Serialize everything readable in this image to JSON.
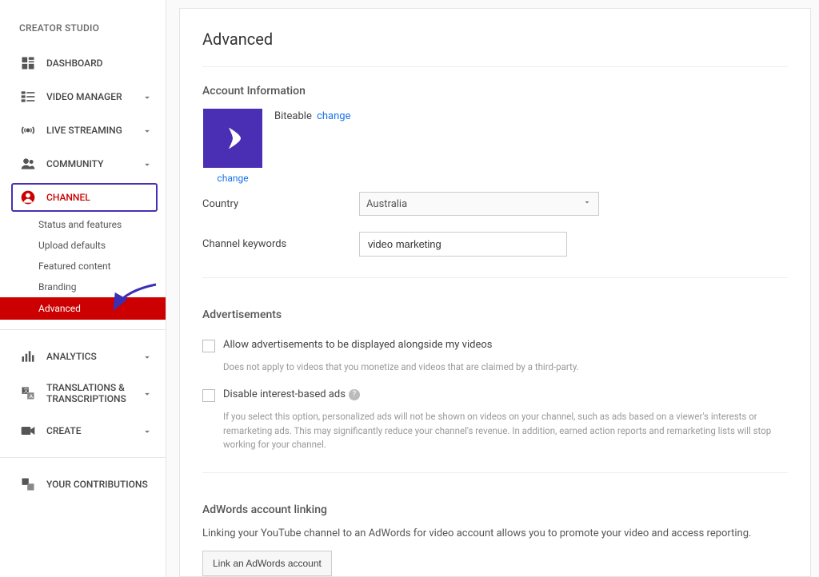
{
  "sidebar": {
    "title": "CREATOR STUDIO",
    "items": [
      {
        "label": "DASHBOARD",
        "icon": "dashboard-icon",
        "chevron": false
      },
      {
        "label": "VIDEO MANAGER",
        "icon": "video-manager-icon",
        "chevron": true
      },
      {
        "label": "LIVE STREAMING",
        "icon": "live-streaming-icon",
        "chevron": true
      },
      {
        "label": "COMMUNITY",
        "icon": "community-icon",
        "chevron": true
      },
      {
        "label": "CHANNEL",
        "icon": "channel-icon",
        "chevron": true,
        "active": true
      },
      {
        "label": "ANALYTICS",
        "icon": "analytics-icon",
        "chevron": true
      },
      {
        "label": "TRANSLATIONS & TRANSCRIPTIONS",
        "icon": "translations-icon",
        "chevron": true
      },
      {
        "label": "CREATE",
        "icon": "create-icon",
        "chevron": true
      },
      {
        "label": "YOUR CONTRIBUTIONS",
        "icon": "contributions-icon",
        "chevron": false
      }
    ],
    "channel_subitems": [
      "Status and features",
      "Upload defaults",
      "Featured content",
      "Branding",
      "Advanced"
    ]
  },
  "page": {
    "title": "Advanced",
    "account": {
      "section_title": "Account Information",
      "name": "Biteable",
      "change_link": "change",
      "change_avatar": "change",
      "country_label": "Country",
      "country_value": "Australia",
      "keywords_label": "Channel keywords",
      "keywords_value": "video marketing"
    },
    "ads": {
      "section_title": "Advertisements",
      "allow_label": "Allow advertisements to be displayed alongside my videos",
      "allow_help": "Does not apply to videos that you monetize and videos that are claimed by a third-party.",
      "disable_label": "Disable interest-based ads",
      "disable_help": "If you select this option, personalized ads will not be shown on videos on your channel, such as ads based on a viewer's interests or remarketing ads. This may significantly reduce your channel's revenue. In addition, earned action reports and remarketing lists will stop working for your channel."
    },
    "adwords": {
      "section_title": "AdWords account linking",
      "desc": "Linking your YouTube channel to an AdWords for video account allows you to promote your video and access reporting.",
      "button": "Link an AdWords account"
    }
  }
}
